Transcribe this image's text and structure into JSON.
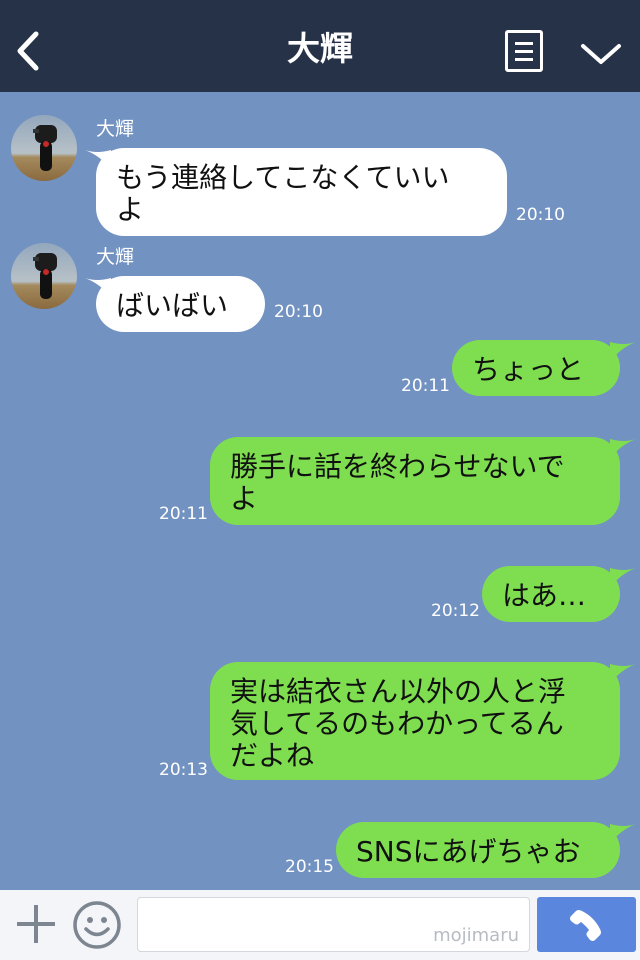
{
  "header": {
    "title": "大輝"
  },
  "messages": [
    {
      "direction": "in",
      "sender": "大輝",
      "text": "もう連絡してこなくていい\nよ",
      "time": "20:10"
    },
    {
      "direction": "in",
      "sender": "大輝",
      "text": "ばいばい",
      "time": "20:10"
    },
    {
      "direction": "out",
      "text": "ちょっと",
      "time": "20:11"
    },
    {
      "direction": "out",
      "text": "勝手に話を終わらせないで\nよ",
      "time": "20:11"
    },
    {
      "direction": "out",
      "text": "はあ…",
      "time": "20:12"
    },
    {
      "direction": "out",
      "text": "実は結衣さん以外の人と浮\n気してるのもわかってるん\nだよね",
      "time": "20:13"
    },
    {
      "direction": "out",
      "text": "SNSにあげちゃお",
      "time": "20:15"
    }
  ],
  "input": {
    "placeholder": "",
    "watermark": "mojimaru"
  },
  "icons": {
    "back": "chevron-left-icon",
    "menu": "menu-list-icon",
    "collapse": "chevron-down-icon",
    "plus": "plus-icon",
    "emoji": "smiley-icon",
    "send": "phone-icon"
  },
  "colors": {
    "header_bg": "#263247",
    "chat_bg": "#7292c1",
    "incoming_bubble": "#ffffff",
    "outgoing_bubble": "#7ede4f",
    "send_button": "#5b86dd"
  }
}
